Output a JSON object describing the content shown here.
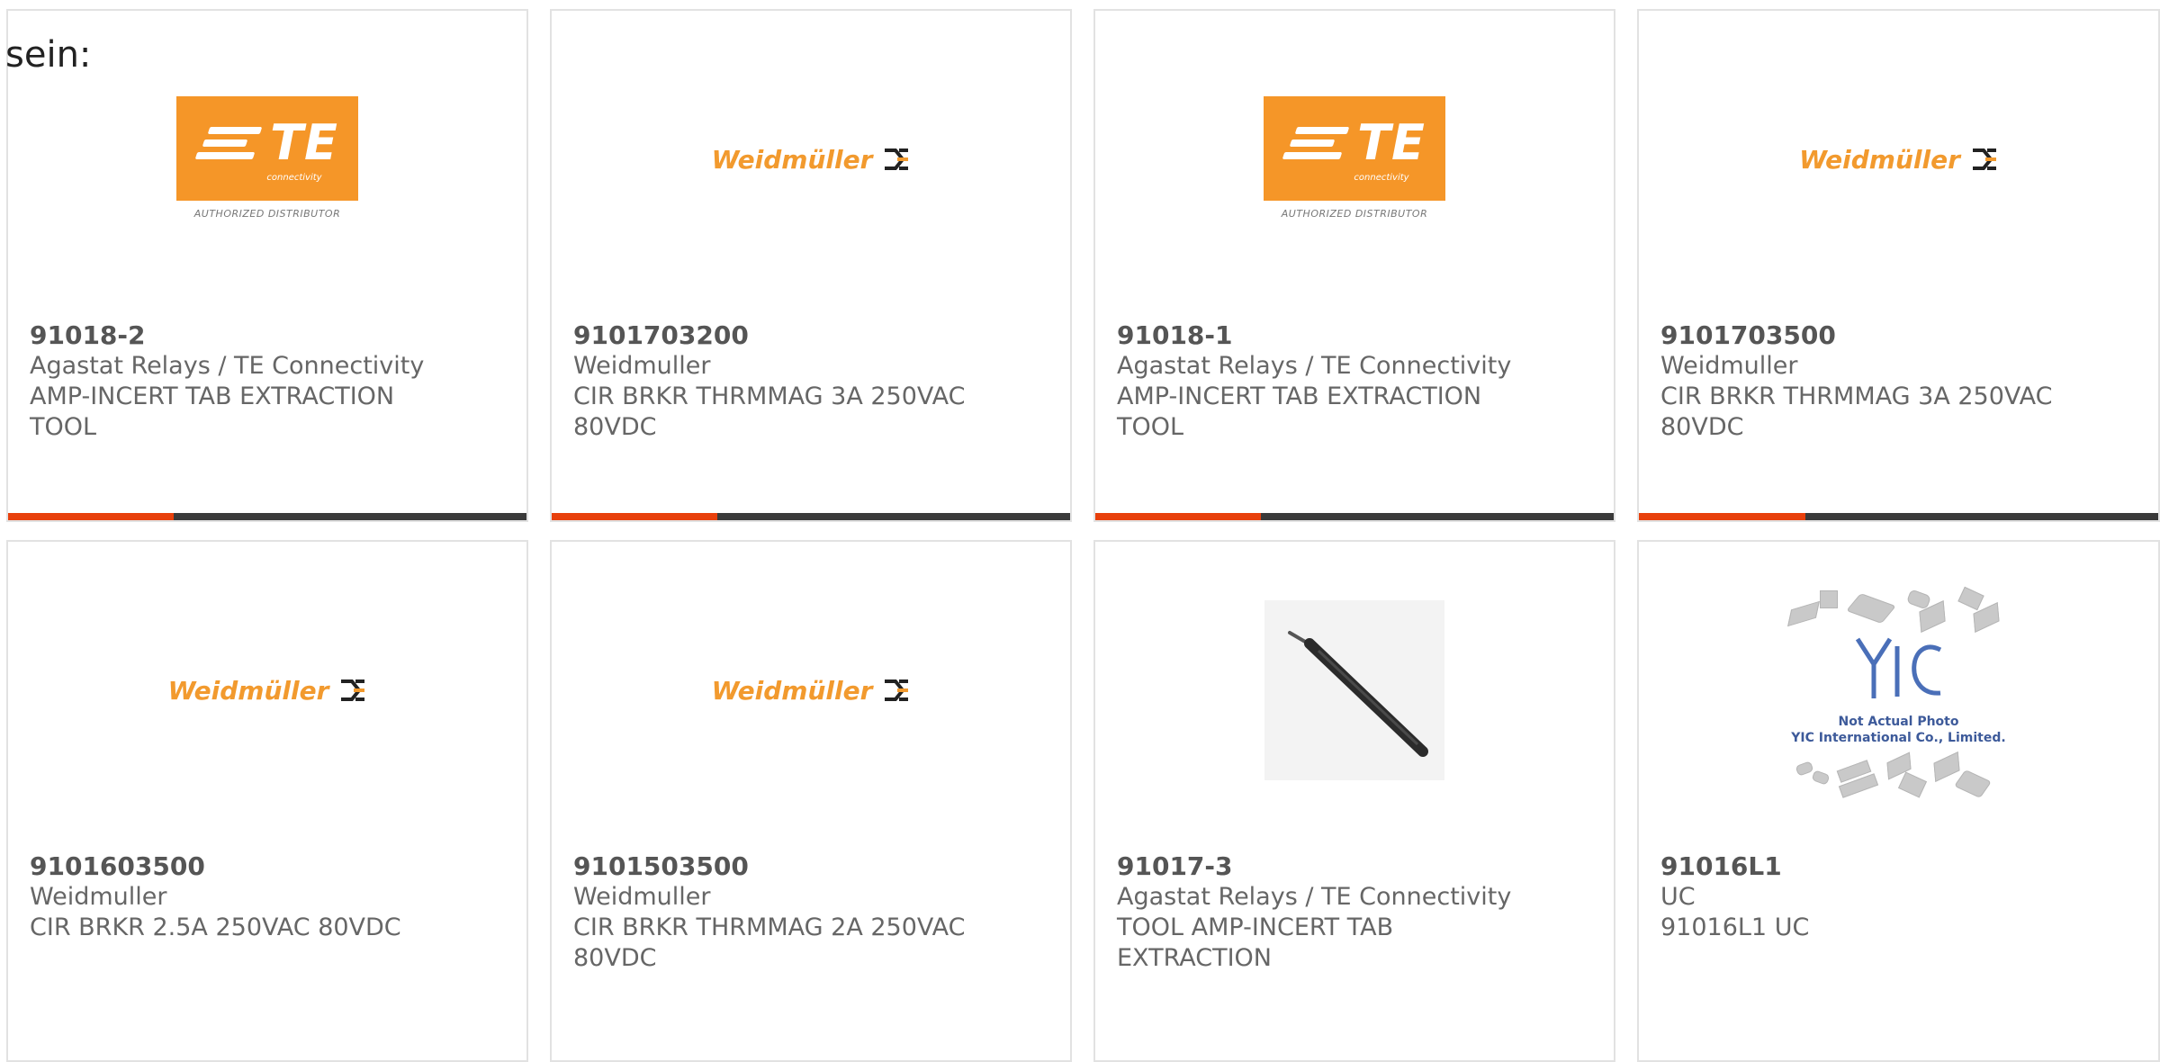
{
  "page": {
    "intro_text": "sein:"
  },
  "colors": {
    "accent_bar": "#e8400c",
    "bar_dark": "#3a3a3a",
    "te_orange": "#f59628",
    "weidmuller_orange": "#f29a2e"
  },
  "logos": {
    "te": {
      "letters": "TE",
      "sub": "connectivity",
      "tagline": "AUTHORIZED DISTRIBUTOR",
      "icon": "te-connectivity-logo"
    },
    "weidmuller": {
      "name": "Weidmüller",
      "icon": "weidmuller-logo"
    },
    "yic": {
      "caption_1": "Not Actual Photo",
      "caption_2": "YIC International Co., Limited.",
      "icon": "yic-placeholder-logo"
    },
    "tool": {
      "icon": "extraction-tool-photo"
    }
  },
  "products": [
    {
      "part_number": "91018-2",
      "manufacturer": "Agastat Relays / TE Connectivity",
      "description": "AMP-INCERT TAB EXTRACTION TOOL",
      "logo": "te"
    },
    {
      "part_number": "9101703200",
      "manufacturer": "Weidmuller",
      "description": "CIR BRKR THRMMAG 3A 250VAC 80VDC",
      "logo": "weidmuller"
    },
    {
      "part_number": "91018-1",
      "manufacturer": "Agastat Relays / TE Connectivity",
      "description": "AMP-INCERT TAB EXTRACTION TOOL",
      "logo": "te"
    },
    {
      "part_number": "9101703500",
      "manufacturer": "Weidmuller",
      "description": "CIR BRKR THRMMAG 3A 250VAC 80VDC",
      "logo": "weidmuller"
    },
    {
      "part_number": "9101603500",
      "manufacturer": "Weidmuller",
      "description": "CIR BRKR 2.5A 250VAC 80VDC",
      "logo": "weidmuller"
    },
    {
      "part_number": "9101503500",
      "manufacturer": "Weidmuller",
      "description": "CIR BRKR THRMMAG 2A 250VAC 80VDC",
      "logo": "weidmuller"
    },
    {
      "part_number": "91017-3",
      "manufacturer": "Agastat Relays / TE Connectivity",
      "description": "TOOL AMP-INCERT TAB EXTRACTION",
      "logo": "tool"
    },
    {
      "part_number": "91016L1",
      "manufacturer": "UC",
      "description": "91016L1 UC",
      "logo": "yic"
    }
  ]
}
